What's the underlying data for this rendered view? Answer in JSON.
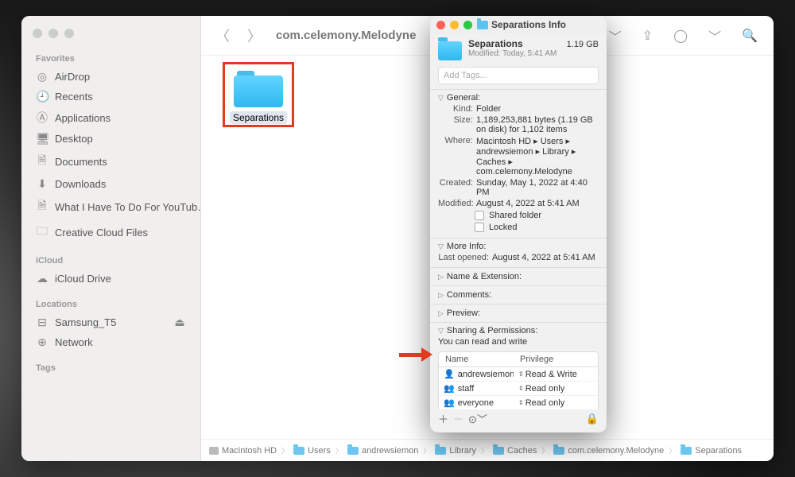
{
  "finder": {
    "title": "com.celemony.Melodyne",
    "folder_name": "Separations",
    "sidebar": {
      "favorites_label": "Favorites",
      "items": [
        {
          "label": "AirDrop",
          "icon": "◎"
        },
        {
          "label": "Recents",
          "icon": "🕘"
        },
        {
          "label": "Applications",
          "icon": "Ⓐ"
        },
        {
          "label": "Desktop",
          "icon": "🖥"
        },
        {
          "label": "Documents",
          "icon": "🗎"
        },
        {
          "label": "Downloads",
          "icon": "⬇"
        },
        {
          "label": "What I Have To Do For YouTub…",
          "icon": "🗎"
        },
        {
          "label": "Creative Cloud Files",
          "icon": "🗀"
        }
      ],
      "icloud_label": "iCloud",
      "icloud_items": [
        {
          "label": "iCloud Drive",
          "icon": "☁"
        }
      ],
      "locations_label": "Locations",
      "locations_items": [
        {
          "label": "Samsung_T5",
          "icon": "⊟"
        },
        {
          "label": "Network",
          "icon": "⊕"
        }
      ],
      "tags_label": "Tags"
    },
    "pathbar": [
      "Macintosh HD",
      "Users",
      "andrewsiemon",
      "Library",
      "Caches",
      "com.celemony.Melodyne",
      "Separations"
    ]
  },
  "info": {
    "window_title": "Separations Info",
    "name": "Separations",
    "size_short": "1.19 GB",
    "modified_short": "Modified: Today, 5:41 AM",
    "tags_placeholder": "Add Tags...",
    "sections": {
      "general_label": "General:",
      "kind_k": "Kind:",
      "kind_v": "Folder",
      "size_k": "Size:",
      "size_v": "1,189,253,881 bytes (1.19 GB on disk) for 1,102 items",
      "where_k": "Where:",
      "where_v": "Macintosh HD ▸ Users ▸ andrewsiemon ▸ Library ▸ Caches ▸ com.celemony.Melodyne",
      "created_k": "Created:",
      "created_v": "Sunday, May 1, 2022 at 4:40 PM",
      "modified_k": "Modified:",
      "modified_v": "August 4, 2022 at 5:41 AM",
      "shared_folder": "Shared folder",
      "locked": "Locked",
      "moreinfo_label": "More Info:",
      "lastopened_k": "Last opened:",
      "lastopened_v": "August 4, 2022 at 5:41 AM",
      "nameext_label": "Name & Extension:",
      "comments_label": "Comments:",
      "preview_label": "Preview:",
      "sharing_label": "Sharing & Permissions:",
      "sharing_text": "You can read and write",
      "col_name": "Name",
      "col_priv": "Privilege",
      "perms": [
        {
          "user": "andrewsiemon…",
          "priv": "Read & Write",
          "icon": "single"
        },
        {
          "user": "staff",
          "priv": "Read only",
          "icon": "group"
        },
        {
          "user": "everyone",
          "priv": "Read only",
          "icon": "group"
        }
      ]
    }
  }
}
